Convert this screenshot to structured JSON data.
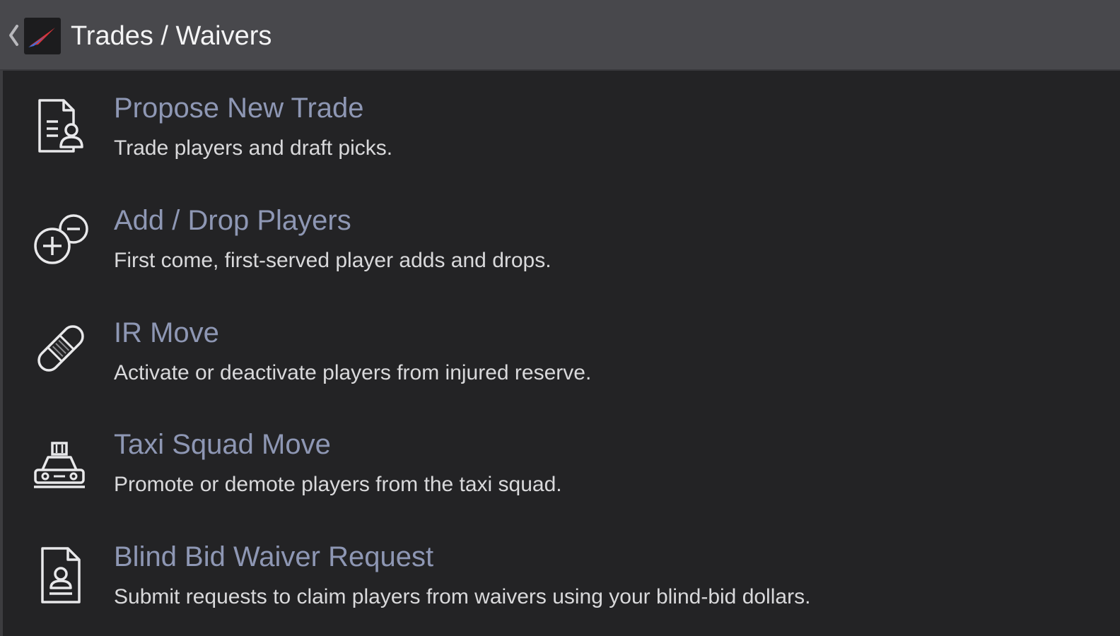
{
  "header": {
    "title": "Trades / Waivers",
    "back_icon": "chevron-left-icon",
    "logo_icon": "app-logo"
  },
  "menu": [
    {
      "label": "Propose New Trade",
      "description": "Trade players and draft picks.",
      "icon": "trade-document-icon"
    },
    {
      "label": "Add / Drop Players",
      "description": "First come, first-served player adds and drops.",
      "icon": "add-drop-icon"
    },
    {
      "label": "IR Move",
      "description": "Activate or deactivate players from injured reserve.",
      "icon": "bandage-icon"
    },
    {
      "label": "Taxi Squad Move",
      "description": "Promote or demote players from the taxi squad.",
      "icon": "taxi-icon"
    },
    {
      "label": "Blind Bid Waiver Request",
      "description": "Submit requests to claim players from waivers using your blind-bid dollars.",
      "icon": "waiver-document-icon"
    }
  ],
  "colors": {
    "header_bg": "#48484c",
    "page_bg": "#232325",
    "link_text": "#8e97b4",
    "desc_text": "#d9d9db",
    "title_text": "#f4f4f5"
  }
}
